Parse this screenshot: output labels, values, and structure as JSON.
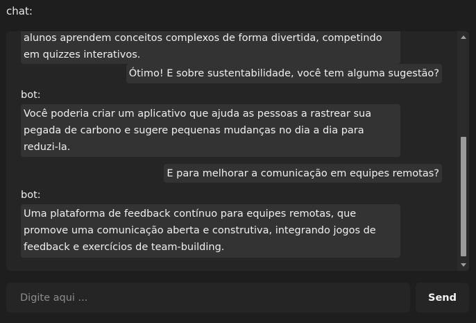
{
  "header": {
    "title": "chat:"
  },
  "chat": {
    "bot_label": "bot:",
    "messages": [
      {
        "role": "bot",
        "text": "Outras ideias incluem uma plataforma de jogos educacionais onde os alunos aprendem conceitos complexos de forma divertida, competindo em quizzes interativos."
      },
      {
        "role": "user",
        "text": "Ótimo! E sobre sustentabilidade, você tem alguma sugestão?"
      },
      {
        "role": "bot",
        "text": "Você poderia criar um aplicativo que ajuda as pessoas a rastrear sua pegada de carbono e sugere pequenas mudanças no dia a dia para reduzi-la."
      },
      {
        "role": "user",
        "text": "E para melhorar a comunicação em equipes remotas?"
      },
      {
        "role": "bot",
        "text": "Uma plataforma de feedback contínuo para equipes remotas, que promove uma comunicação aberta e construtiva, integrando jogos de feedback e exercícios de team-building."
      }
    ]
  },
  "composer": {
    "placeholder": "Digite aqui ...",
    "send_label": "Send"
  },
  "icons": {
    "scroll_up": "chevron-up-icon",
    "scroll_down": "chevron-down-icon"
  },
  "colors": {
    "background": "#1e1e1e",
    "panel": "#252525",
    "bubble": "#333333",
    "scroll_thumb": "#9b9b9b"
  }
}
